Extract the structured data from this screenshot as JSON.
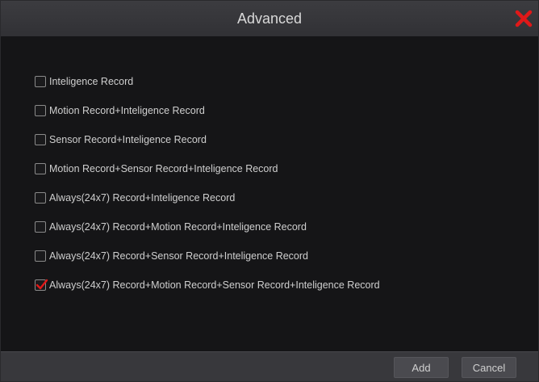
{
  "dialog": {
    "title": "Advanced",
    "close_icon": "close-icon",
    "accent_color": "#e01818"
  },
  "options": [
    {
      "label": "Inteligence Record",
      "checked": false
    },
    {
      "label": "Motion Record+Inteligence Record",
      "checked": false
    },
    {
      "label": "Sensor Record+Inteligence Record",
      "checked": false
    },
    {
      "label": "Motion Record+Sensor Record+Inteligence Record",
      "checked": false
    },
    {
      "label": "Always(24x7) Record+Inteligence Record",
      "checked": false
    },
    {
      "label": "Always(24x7) Record+Motion Record+Inteligence Record",
      "checked": false
    },
    {
      "label": "Always(24x7) Record+Sensor Record+Inteligence Record",
      "checked": false
    },
    {
      "label": "Always(24x7) Record+Motion Record+Sensor Record+Inteligence Record",
      "checked": true
    }
  ],
  "footer": {
    "add_label": "Add",
    "cancel_label": "Cancel"
  }
}
